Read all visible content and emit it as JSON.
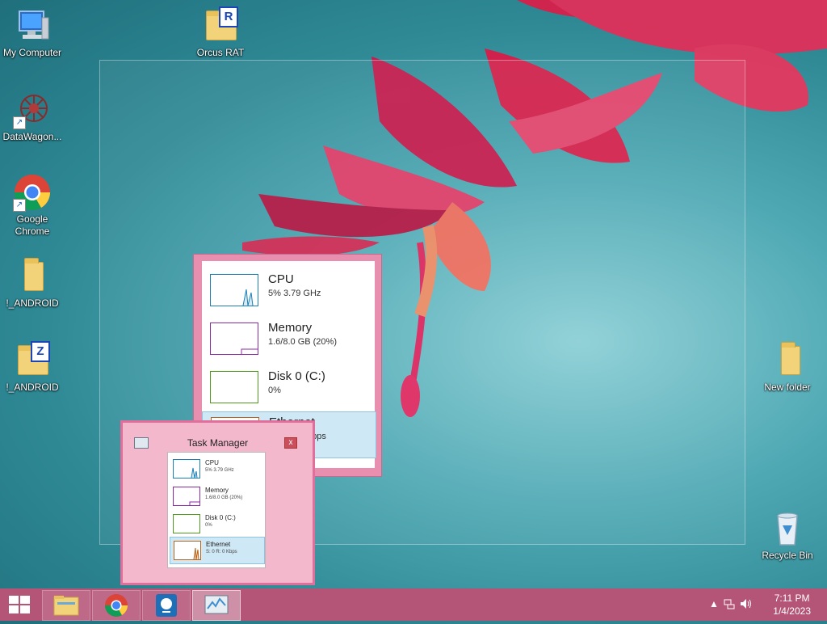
{
  "desktop": {
    "icons": [
      {
        "label": "My Computer"
      },
      {
        "label": "DataWagon..."
      },
      {
        "label": "Google Chrome"
      },
      {
        "label": "!_ANDROID"
      },
      {
        "label": "!_ANDROID",
        "badge": "Z"
      },
      {
        "label": "Orcus RAT",
        "badge": "R"
      },
      {
        "label": "New folder"
      },
      {
        "label": "Recycle Bin"
      }
    ]
  },
  "perf_widget": {
    "rows": [
      {
        "title": "CPU",
        "sub": "5% 3.79 GHz",
        "color": "#1b7fb5"
      },
      {
        "title": "Memory",
        "sub": "1.6/8.0 GB (20%)",
        "color": "#8b2ba3"
      },
      {
        "title": "Disk 0 (C:)",
        "sub": "0%",
        "color": "#4e9a1e"
      },
      {
        "title": "Ethernet",
        "sub": "S: 0 R: 0 Kbps",
        "color": "#b8631a"
      }
    ]
  },
  "task_manager": {
    "title": "Task Manager",
    "close_label": "x",
    "rows": [
      {
        "title": "CPU",
        "sub": "5% 3.79 GHz"
      },
      {
        "title": "Memory",
        "sub": "1.6/8.0 GB (20%)"
      },
      {
        "title": "Disk 0 (C:)",
        "sub": "0%"
      },
      {
        "title": "Ethernet",
        "sub": "S: 0 R: 0 Kbps"
      }
    ]
  },
  "taskbar": {
    "clock": {
      "time": "7:11 PM",
      "date": "1/4/2023"
    },
    "tray_icons": [
      "chevron-up-icon",
      "network-icon",
      "volume-icon"
    ],
    "pinned": [
      "file-explorer-icon",
      "chrome-icon",
      "app-icon",
      "task-manager-icon"
    ]
  }
}
